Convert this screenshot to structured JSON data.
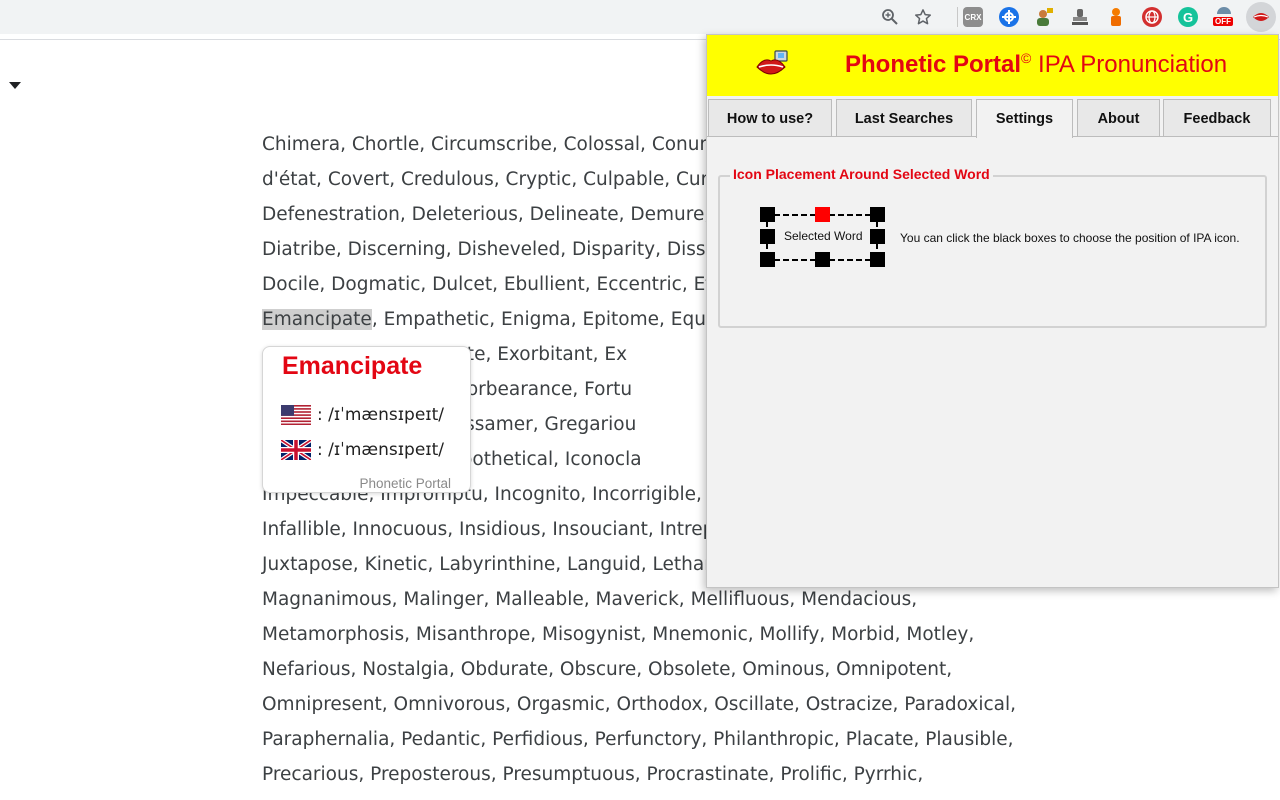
{
  "toolbar": {
    "zoom_icon": "zoom-magnifier-icon",
    "star_icon": "bookmark-star-icon",
    "extensions": [
      {
        "name": "crx-extension-icon",
        "label": "CRX"
      },
      {
        "name": "blue-cross-extension-icon",
        "label": ""
      },
      {
        "name": "person-key-extension-icon",
        "label": ""
      },
      {
        "name": "stamp-extension-icon",
        "label": ""
      },
      {
        "name": "orange-figure-extension-icon",
        "label": ""
      },
      {
        "name": "red-globe-extension-icon",
        "label": ""
      },
      {
        "name": "grammarly-extension-icon",
        "label": ""
      },
      {
        "name": "off-extension-icon",
        "label": "OFF"
      },
      {
        "name": "phonetic-portal-extension-icon",
        "label": ""
      }
    ]
  },
  "article": {
    "lines": [
      "Chimera, Chortle, Circumscribe, Colossal, Conund",
      "d'état, Covert, Credulous, Cryptic, Culpable, Curs",
      "Defenestration, Deleterious, Delineate, Demure, D",
      "Diatribe, Discerning, Disheveled, Disparity, Dissim",
      "Docile, Dogmatic, Dulcet, Ebullient, Eccentric, Effe",
      {
        "highlight": "Emancipate",
        "rest": ", Empathetic, Enigma, Epitome, Equivo"
      },
      "                      Exonerate, Exorbitant, Ex",
      "                      laccid, Forbearance, Fortu",
      "                      Glib, Gossamer, Gregariou",
      "                      ous, Hypothetical, Iconocla",
      "Impeccable, Impromptu, Incognito, Incorrigible, In",
      "Infallible, Innocuous, Insidious, Insouciant, Intrepi",
      "Juxtapose, Kinetic, Labyrinthine, Languid, Letharg",
      "Magnanimous, Malinger, Malleable, Maverick, Mellifluous, Mendacious,",
      "Metamorphosis, Misanthrope, Misogynist, Mnemonic, Mollify, Morbid, Motley,",
      "Nefarious, Nostalgia, Obdurate, Obscure, Obsolete, Ominous, Omnipotent,",
      "Omnipresent, Omnivorous, Orgasmic, Orthodox, Oscillate, Ostracize, Paradoxical,",
      "Paraphernalia, Pedantic, Perfidious, Perfunctory, Philanthropic, Placate, Plausible,",
      "Precarious, Preposterous, Presumptuous, Procrastinate, Prolific, Pyrrhic,"
    ]
  },
  "ipa_card": {
    "word": "Emancipate",
    "us": {
      "flag": "us-flag-icon",
      "ipa": ": /ɪˈmænsɪpeɪt/"
    },
    "uk": {
      "flag": "uk-flag-icon",
      "ipa": ": /ɪˈmænsɪpeɪt/"
    },
    "brand": "Phonetic Portal"
  },
  "popup": {
    "title_brand": "Phonetic Portal",
    "title_mark": "©",
    "title_rest": " IPA Pronunciation",
    "tabs": [
      "How to use?",
      "Last Searches",
      "Settings",
      "About",
      "Feedback"
    ],
    "active_tab": "Settings",
    "settings": {
      "legend": "Icon Placement Around Selected Word",
      "selected_word": "Selected Word",
      "hint": "You can click the black boxes to choose the position of IPA icon.",
      "selected_position": "top-center"
    }
  },
  "colors": {
    "brand_red": "#e30613",
    "header_yellow": "#ffff00",
    "selected_box": "#ff0000"
  }
}
